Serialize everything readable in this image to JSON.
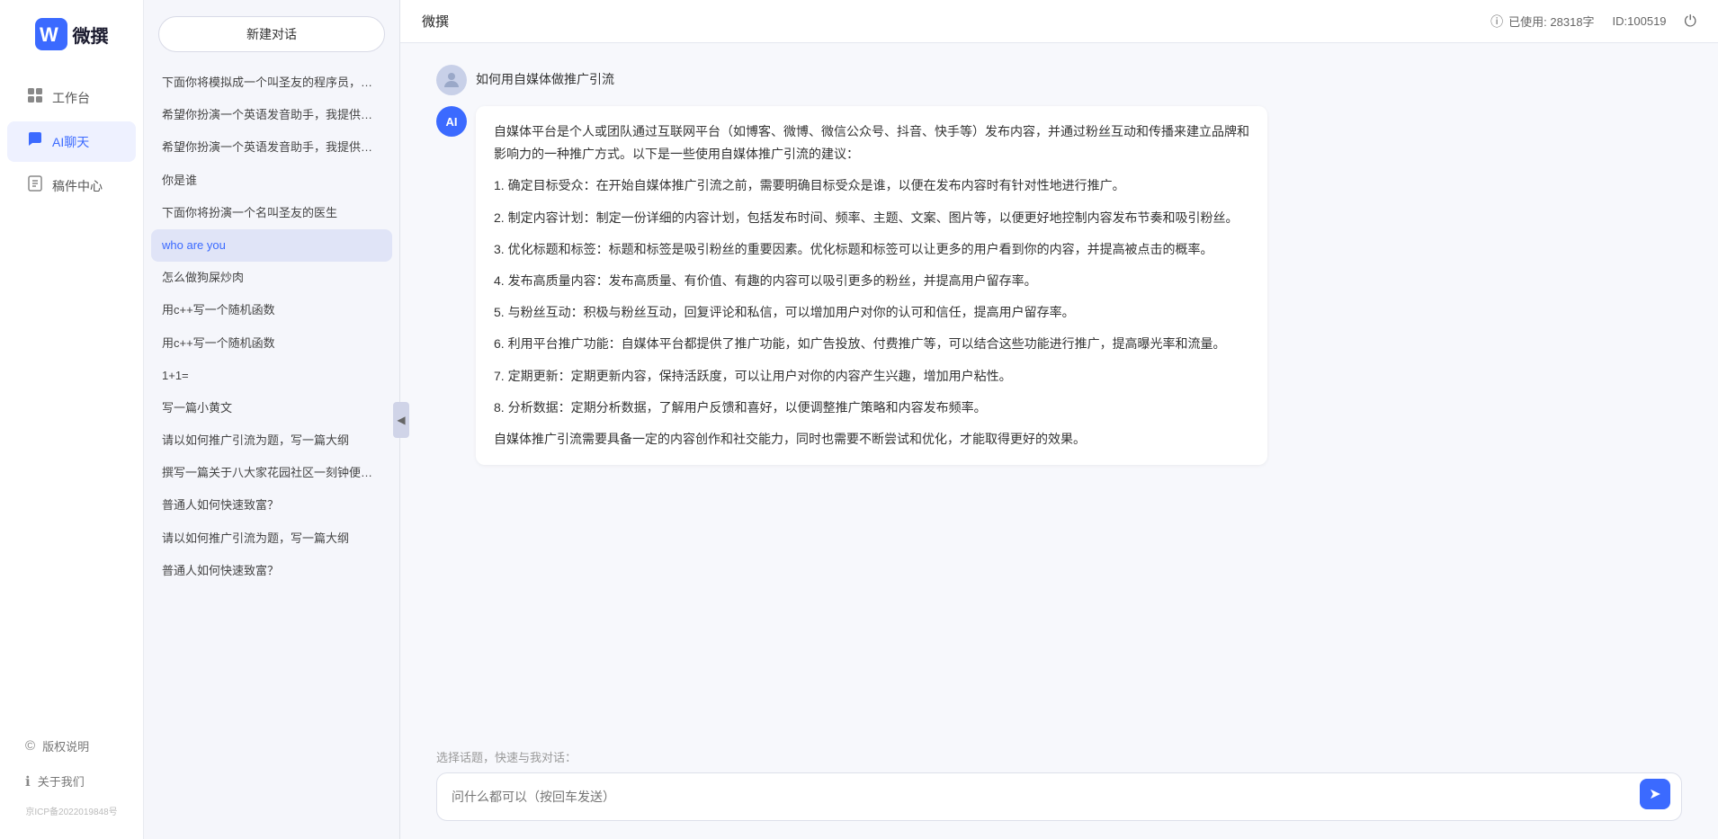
{
  "app": {
    "name": "微撰",
    "logo_letter": "W"
  },
  "topbar": {
    "title": "微撰",
    "usage_icon": "ℹ",
    "usage_label": "已使用: 28318字",
    "id_label": "ID:100519",
    "power_icon": "⏻"
  },
  "nav": {
    "items": [
      {
        "id": "workspace",
        "label": "工作台",
        "icon": "⊞"
      },
      {
        "id": "ai-chat",
        "label": "AI聊天",
        "icon": "💬",
        "active": true
      },
      {
        "id": "drafts",
        "label": "稿件中心",
        "icon": "📄"
      }
    ],
    "bottom_items": [
      {
        "id": "copyright",
        "label": "版权说明",
        "icon": "©"
      },
      {
        "id": "about",
        "label": "关于我们",
        "icon": "ℹ"
      }
    ],
    "icp": "京ICP备2022019848号"
  },
  "middle_panel": {
    "new_chat_label": "新建对话",
    "history": [
      {
        "id": 1,
        "text": "下面你将模拟成一个叫圣友的程序员，我说..."
      },
      {
        "id": 2,
        "text": "希望你扮演一个英语发音助手，我提供给你..."
      },
      {
        "id": 3,
        "text": "希望你扮演一个英语发音助手，我提供给你..."
      },
      {
        "id": 4,
        "text": "你是谁"
      },
      {
        "id": 5,
        "text": "下面你将扮演一个名叫圣友的医生"
      },
      {
        "id": 6,
        "text": "who are you",
        "active": true
      },
      {
        "id": 7,
        "text": "怎么做狗屎炒肉"
      },
      {
        "id": 8,
        "text": "用c++写一个随机函数"
      },
      {
        "id": 9,
        "text": "用c++写一个随机函数"
      },
      {
        "id": 10,
        "text": "1+1="
      },
      {
        "id": 11,
        "text": "写一篇小黄文"
      },
      {
        "id": 12,
        "text": "请以如何推广引流为题，写一篇大纲"
      },
      {
        "id": 13,
        "text": "撰写一篇关于八大家花园社区一刻钟便民生..."
      },
      {
        "id": 14,
        "text": "普通人如何快速致富？"
      },
      {
        "id": 15,
        "text": "请以如何推广引流为题，写一篇大纲"
      },
      {
        "id": 16,
        "text": "普通人如何快速致富？"
      }
    ]
  },
  "chat": {
    "user_message": "如何用自媒体做推广引流",
    "ai_response": {
      "paragraphs": [
        "自媒体平台是个人或团队通过互联网平台（如博客、微博、微信公众号、抖音、快手等）发布内容，并通过粉丝互动和传播来建立品牌和影响力的一种推广方式。以下是一些使用自媒体推广引流的建议：",
        "1. 确定目标受众：在开始自媒体推广引流之前，需要明确目标受众是谁，以便在发布内容时有针对性地进行推广。",
        "2. 制定内容计划：制定一份详细的内容计划，包括发布时间、频率、主题、文案、图片等，以便更好地控制内容发布节奏和吸引粉丝。",
        "3. 优化标题和标签：标题和标签是吸引粉丝的重要因素。优化标题和标签可以让更多的用户看到你的内容，并提高被点击的概率。",
        "4. 发布高质量内容：发布高质量、有价值、有趣的内容可以吸引更多的粉丝，并提高用户留存率。",
        "5. 与粉丝互动：积极与粉丝互动，回复评论和私信，可以增加用户对你的认可和信任，提高用户留存率。",
        "6. 利用平台推广功能：自媒体平台都提供了推广功能，如广告投放、付费推广等，可以结合这些功能进行推广，提高曝光率和流量。",
        "7. 定期更新：定期更新内容，保持活跃度，可以让用户对你的内容产生兴趣，增加用户粘性。",
        "8. 分析数据：定期分析数据，了解用户反馈和喜好，以便调整推广策略和内容发布频率。",
        "自媒体推广引流需要具备一定的内容创作和社交能力，同时也需要不断尝试和优化，才能取得更好的效果。"
      ]
    },
    "quick_topics_label": "选择话题，快速与我对话：",
    "input_placeholder": "问什么都可以（按回车发送）",
    "send_icon": "➤"
  }
}
